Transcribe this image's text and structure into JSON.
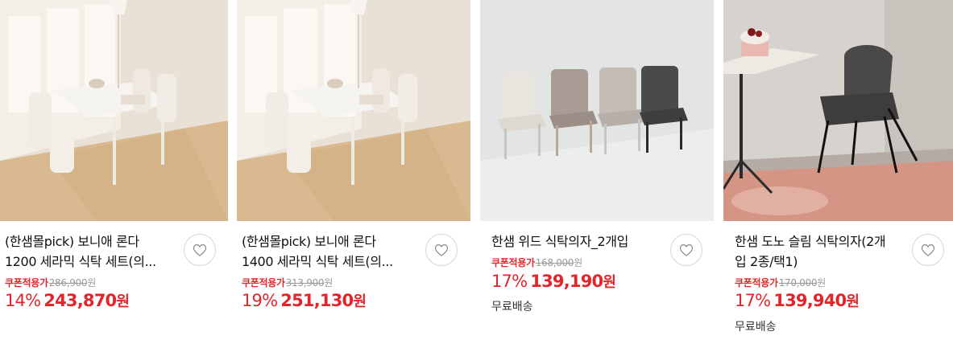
{
  "products": [
    {
      "title": "(한샘몰pick) 보니애 론다\n1200 세라믹 식탁 세트(의...",
      "coupon_label": "쿠폰적용가",
      "original_price": "286,900",
      "won": "원",
      "discount": "14%",
      "sale_price": "243,870",
      "shipping": ""
    },
    {
      "title": "(한샘몰pick) 보니애 론다\n1400 세라믹 식탁 세트(의...",
      "coupon_label": "쿠폰적용가",
      "original_price": "313,900",
      "won": "원",
      "discount": "19%",
      "sale_price": "251,130",
      "shipping": ""
    },
    {
      "title": "한샘 위드 식탁의자_2개입",
      "coupon_label": "쿠폰적용가",
      "original_price": "168,000",
      "won": "원",
      "discount": "17%",
      "sale_price": "139,190",
      "shipping": "무료배송"
    },
    {
      "title": "한샘 도노 슬림 식탁의자(2개\n입 2종/택1)",
      "coupon_label": "쿠폰적용가",
      "original_price": "170,000",
      "won": "원",
      "discount": "17%",
      "sale_price": "139,940",
      "shipping": "무료배송"
    }
  ],
  "icons": {
    "wishlist": "heart-outline-icon"
  },
  "colors": {
    "sale_red": "#e1262b",
    "strike_gray": "#999999"
  }
}
